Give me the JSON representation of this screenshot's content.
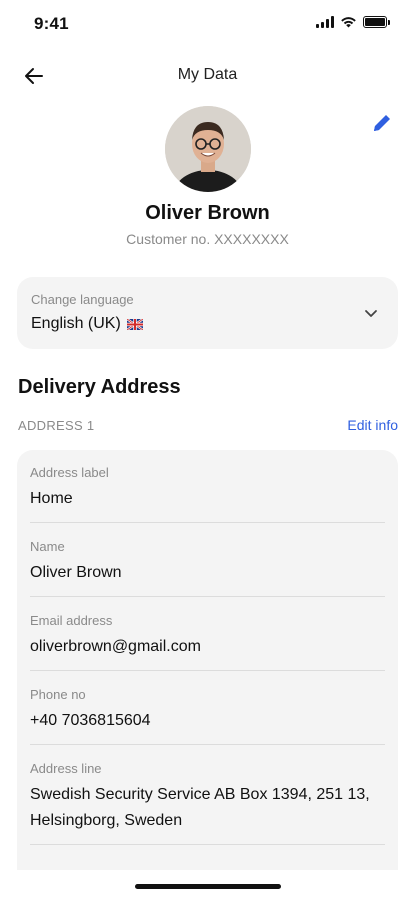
{
  "status_bar": {
    "time": "9:41"
  },
  "header": {
    "title": "My Data"
  },
  "profile": {
    "name": "Oliver Brown",
    "customer_no": "Customer no. XXXXXXXX"
  },
  "language": {
    "label": "Change language",
    "value": "English (UK)"
  },
  "delivery": {
    "section_title": "Delivery Address",
    "address_heading": "ADDRESS 1",
    "edit_label": "Edit info",
    "fields": [
      {
        "label": "Address label",
        "value": "Home"
      },
      {
        "label": "Name",
        "value": "Oliver Brown"
      },
      {
        "label": "Email address",
        "value": "oliverbrown@gmail.com"
      },
      {
        "label": "Phone no",
        "value": "+40 7036815604"
      },
      {
        "label": "Address line",
        "value": "Swedish Security Service AB Box 1394, 251 13, Helsingborg, Sweden"
      }
    ]
  },
  "colors": {
    "accent": "#2f5fe0",
    "card_bg": "#f4f4f4",
    "muted_text": "#8a8a8a"
  }
}
